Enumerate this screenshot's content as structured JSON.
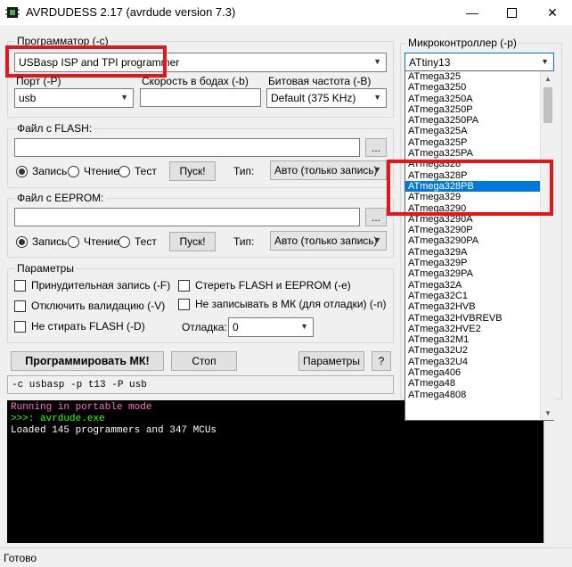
{
  "window": {
    "title": "AVRDUDESS 2.17 (avrdude version 7.3)",
    "minimize_icon": "minimize-icon",
    "maximize_icon": "maximize-icon",
    "close_icon": "close-icon"
  },
  "programmer": {
    "legend": "Программатор (-c)",
    "selected": "USBasp ISP and TPI programmer",
    "port_label": "Порт (-P)",
    "port_value": "usb",
    "baud_label": "Скорость в бодах (-b)",
    "baud_value": "",
    "bitclock_label": "Битовая частота (-B)",
    "bitclock_value": "Default (375 KHz)"
  },
  "flash": {
    "legend": "Файл с FLASH:",
    "path": "",
    "browse": "...",
    "write": "Запись",
    "read": "Чтение",
    "verify": "Тест",
    "go": "Пуск!",
    "type_label": "Тип:",
    "type_value": "Авто (только запись)"
  },
  "eeprom": {
    "legend": "Файл с EEPROM:",
    "path": "",
    "browse": "...",
    "write": "Запись",
    "read": "Чтение",
    "verify": "Тест",
    "go": "Пуск!",
    "type_label": "Тип:",
    "type_value": "Авто (только запись)"
  },
  "options": {
    "legend": "Параметры",
    "force": "Принудительная запись (-F)",
    "disable_verify": "Отключить валидацию (-V)",
    "no_erase": "Не стирать FLASH (-D)",
    "erase": "Стереть FLASH и EEPROM (-e)",
    "no_write": "Не записывать в МК (для отладки) (-n)",
    "debug_label": "Отладка:",
    "debug_value": "0"
  },
  "actions": {
    "program": "Программировать МК!",
    "stop": "Стоп",
    "settings": "Параметры",
    "help": "?"
  },
  "cmdline": "-c usbasp -p t13 -P usb",
  "console": [
    {
      "text": "Running in portable mode",
      "color": "#ff6ec7"
    },
    {
      "text": ">>>: avrdude.exe",
      "color": "#39ff14"
    },
    {
      "text": "Loaded 145 programmers and 347 MCUs",
      "color": "#ffffff"
    }
  ],
  "mcu": {
    "legend": "Микроконтроллер (-p)",
    "selected": "ATtiny13",
    "items": [
      "ATmega325",
      "ATmega3250",
      "ATmega3250A",
      "ATmega3250P",
      "ATmega3250PA",
      "ATmega325A",
      "ATmega325P",
      "ATmega325PA",
      "ATmega328",
      "ATmega328P",
      "ATmega328PB",
      "ATmega329",
      "ATmega3290",
      "ATmega3290A",
      "ATmega3290P",
      "ATmega3290PA",
      "ATmega329A",
      "ATmega329P",
      "ATmega329PA",
      "ATmega32A",
      "ATmega32C1",
      "ATmega32HVB",
      "ATmega32HVBREVB",
      "ATmega32HVE2",
      "ATmega32M1",
      "ATmega32U2",
      "ATmega32U4",
      "ATmega406",
      "ATmega48",
      "ATmega4808"
    ],
    "highlighted": "ATmega328PB"
  },
  "status": "Готово",
  "colors": {
    "accent": "#0078d7",
    "highlight_box": "#e3161c",
    "console_bg": "#000000"
  }
}
